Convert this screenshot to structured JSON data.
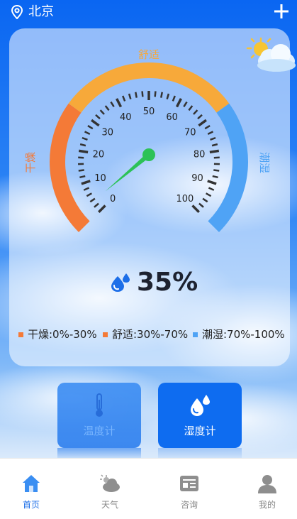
{
  "header": {
    "city": "北京",
    "location_icon": "location-pin-icon",
    "add_icon": "plus-icon"
  },
  "gauge": {
    "min": 0,
    "max": 100,
    "value": 35,
    "major_ticks": [
      "0",
      "10",
      "20",
      "30",
      "40",
      "50",
      "60",
      "70",
      "80",
      "90",
      "100"
    ],
    "zone_labels": {
      "dry": "干燥",
      "comfort": "舒适",
      "humid": "潮湿"
    },
    "colors": {
      "dry": "#f47a37",
      "comfort": "#f7a93a",
      "humid": "#4fa3f5",
      "needle": "#2cc257",
      "tick": "#333333"
    }
  },
  "reading": {
    "text": "35%",
    "icon": "water-drop-icon"
  },
  "legend": [
    {
      "label": "干燥:0%-30%",
      "color": "#f47a37"
    },
    {
      "label": "舒适:30%-70%",
      "color": "#f47a37"
    },
    {
      "label": "潮湿:70%-100%",
      "color": "#4fa3f5"
    }
  ],
  "weather_icon": "partly-cloudy-icon",
  "buttons": {
    "thermometer": "温度计",
    "hygrometer": "湿度计"
  },
  "tabs": [
    {
      "label": "首页",
      "icon": "home-icon",
      "active": true
    },
    {
      "label": "天气",
      "icon": "weather-cloud-icon",
      "active": false
    },
    {
      "label": "咨询",
      "icon": "news-icon",
      "active": false
    },
    {
      "label": "我的",
      "icon": "user-icon",
      "active": false
    }
  ]
}
